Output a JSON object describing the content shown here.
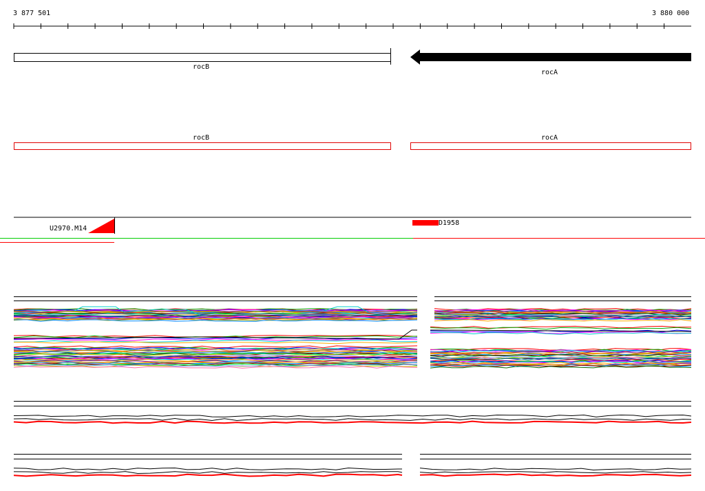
{
  "coords": {
    "start": "3 877 501",
    "end": "3 880 000"
  },
  "genes_top": [
    {
      "name": "rocB",
      "strand": "+"
    },
    {
      "name": "rocA",
      "strand": "-"
    }
  ],
  "genes_mid": [
    {
      "name": "rocB"
    },
    {
      "name": "rocA"
    }
  ],
  "features": [
    {
      "name": "U2970.M14"
    },
    {
      "name": "D1958"
    }
  ],
  "colors": {
    "axis": "#000000",
    "gene_fill": "#000000",
    "gene_outline_mid": "#e00000",
    "feature": "#ff0000",
    "track_green": "#00cc00",
    "track_red": "#ff0000",
    "palette": [
      "#ff0000",
      "#00aa00",
      "#0000ff",
      "#ff00ff",
      "#00cccc",
      "#ffaa00",
      "#880088",
      "#aaaa00",
      "#ff8800",
      "#0088ff",
      "#aa0000",
      "#006600",
      "#00ff66",
      "#cccc00",
      "#8888ff",
      "#ff66aa",
      "#000088",
      "#008888"
    ]
  }
}
